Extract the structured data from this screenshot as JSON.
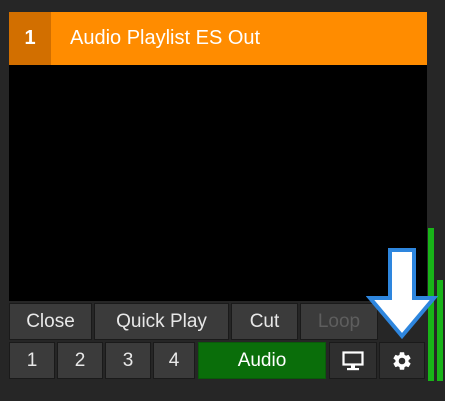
{
  "title_bar": {
    "number": "1",
    "title": "Audio Playlist ES Out"
  },
  "row1_buttons": [
    {
      "label": "Close"
    },
    {
      "label": "Quick Play"
    },
    {
      "label": "Cut"
    },
    {
      "label": "Loop",
      "disabled": true
    }
  ],
  "row2_buttons": [
    {
      "label": "1"
    },
    {
      "label": "2"
    },
    {
      "label": "3"
    },
    {
      "label": "4"
    },
    {
      "label": "Audio"
    }
  ],
  "icons": {
    "monitor": "monitor-icon",
    "settings": "gear-icon",
    "arrow": "down-arrow-icon"
  },
  "colors": {
    "accent": "#ff8c00",
    "number_box": "#d26f00",
    "audio_button": "#0a6e0a",
    "meter": "#18b418",
    "arrow_outline": "#2e86de"
  },
  "audio_meter": {
    "left_level": 0.41,
    "right_level": 0.27
  }
}
